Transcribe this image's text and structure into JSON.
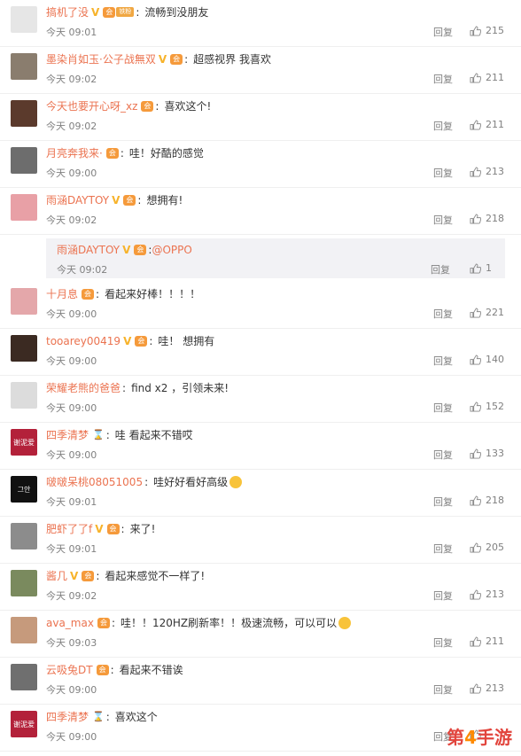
{
  "labels": {
    "reply": "回复"
  },
  "rows": [
    {
      "user": "搞机了没",
      "v": true,
      "member": true,
      "level": "铁粉",
      "hourglass": false,
      "text": "流畅到没朋友",
      "time": "今天 09:01",
      "likes": "215",
      "avatar": "#e6e6e6"
    },
    {
      "user": "墨染肖如玉·公子战無双",
      "v": true,
      "member": true,
      "hourglass": false,
      "text": "超感视界 我喜欢",
      "time": "今天 09:02",
      "likes": "211",
      "avatar": "#8a7d6e"
    },
    {
      "user": "今天也要开心呀_xz",
      "v": false,
      "member": true,
      "hourglass": false,
      "text": "喜欢这个!",
      "time": "今天 09:02",
      "likes": "211",
      "avatar": "#5b3a2c"
    },
    {
      "user": "月亮奔我来·",
      "v": false,
      "member": true,
      "hourglass": false,
      "text": "哇！好酷的感觉",
      "time": "今天 09:00",
      "likes": "213",
      "avatar": "#6d6d6d"
    },
    {
      "user": "雨涵DAYTOY",
      "v": true,
      "member": true,
      "hourglass": false,
      "text": "想拥有!",
      "time": "今天 09:02",
      "likes": "218",
      "avatar": "#e8a0a6"
    },
    {
      "user": "十月息",
      "v": false,
      "member": true,
      "hourglass": false,
      "text": "看起来好棒！！！！",
      "time": "今天 09:00",
      "likes": "221",
      "avatar": "#e4a7aa"
    },
    {
      "user": "tooarey00419",
      "v": true,
      "member": true,
      "hourglass": false,
      "text": "哇！ 想拥有",
      "time": "今天 09:00",
      "likes": "140",
      "avatar": "#3b2a22"
    },
    {
      "user": "荣耀老熊的爸爸",
      "v": false,
      "member": false,
      "hourglass": false,
      "text": "find x2 ，引领未来!",
      "time": "今天 09:00",
      "likes": "152",
      "avatar": "#dcdcdc"
    },
    {
      "user": "四季清梦",
      "v": false,
      "member": false,
      "hourglass": true,
      "text": "哇  看起来不错哎",
      "time": "今天 09:00",
      "likes": "133",
      "avatar": "#b3213a",
      "avatar_text": "谢泥爱"
    },
    {
      "user": "啵啵呆桃08051005",
      "v": false,
      "member": false,
      "hourglass": false,
      "text": "哇好好看好高级",
      "time": "今天 09:01",
      "likes": "218",
      "avatar": "#111111",
      "avatar_text": "그안",
      "emoji": true
    },
    {
      "user": "肥虾了了f",
      "v": true,
      "member": true,
      "hourglass": false,
      "text": "来了!",
      "time": "今天 09:01",
      "likes": "205",
      "avatar": "#8c8c8c"
    },
    {
      "user": "酱几",
      "v": true,
      "member": true,
      "hourglass": false,
      "text": "看起来感觉不一样了!",
      "time": "今天 09:02",
      "likes": "213",
      "avatar": "#7a8a5e"
    },
    {
      "user": "ava_max",
      "v": false,
      "member": true,
      "hourglass": false,
      "text": "哇！！120HZ刷新率！！极速流畅，可以可以",
      "time": "今天 09:03",
      "likes": "211",
      "avatar": "#c69a7c",
      "emoji": true
    },
    {
      "user": "云吸兔DT",
      "v": false,
      "member": true,
      "hourglass": false,
      "text": "看起来不错诶",
      "time": "今天 09:00",
      "likes": "213",
      "avatar": "#6f6f6f"
    },
    {
      "user": "四季清梦",
      "v": false,
      "member": false,
      "hourglass": true,
      "text": "喜欢这个",
      "time": "今天 09:00",
      "likes": "",
      "avatar": "#b3213a",
      "avatar_text": "谢泥爱"
    }
  ],
  "subreply": {
    "user": "雨涵DAYTOY",
    "v": true,
    "member": true,
    "mention": "@OPPO",
    "time": "今天 09:02",
    "likes": "1"
  },
  "watermark": {
    "pre": "第",
    "num": "4",
    "post": "手游"
  }
}
